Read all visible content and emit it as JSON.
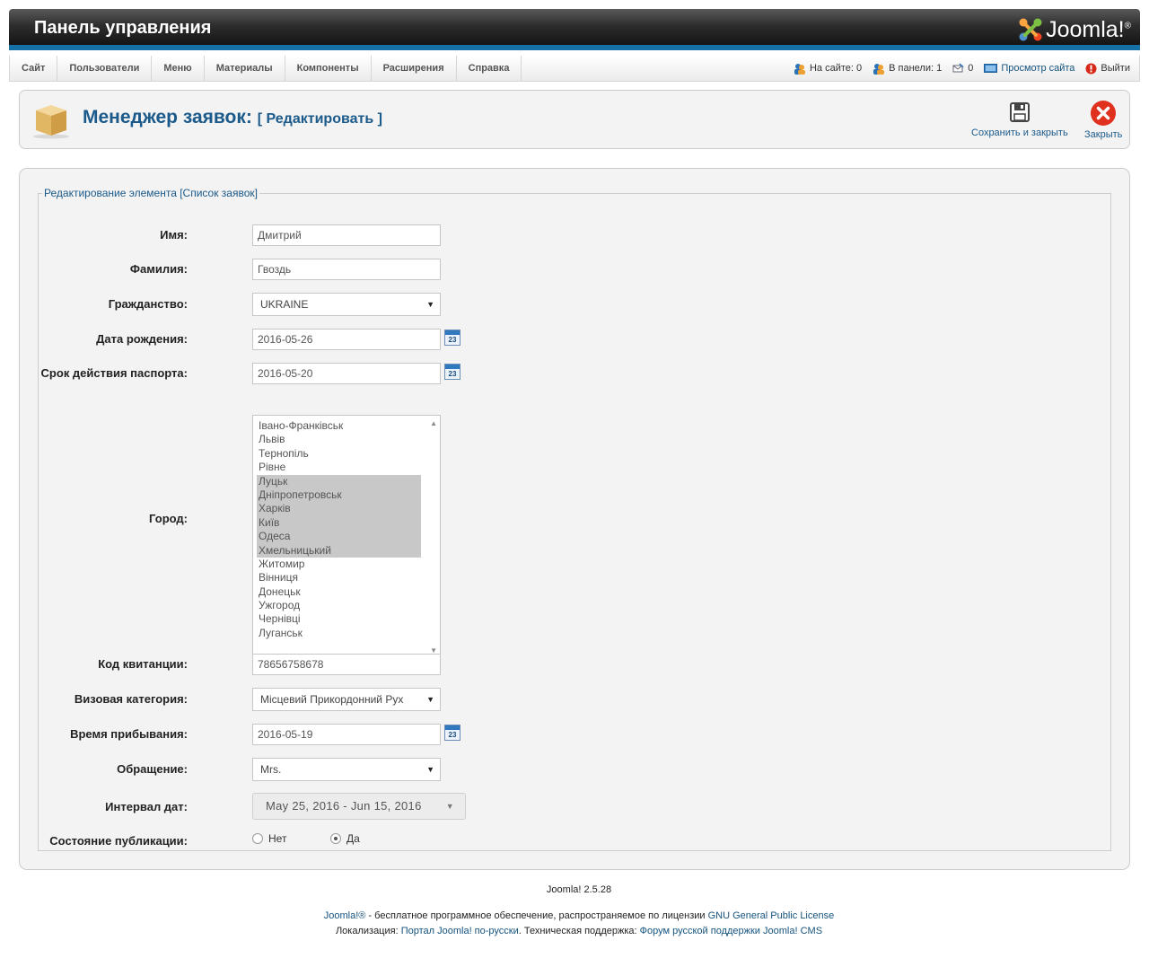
{
  "header": {
    "title": "Панель управления",
    "logo_text": "Joomla!",
    "logo_mark": "®"
  },
  "menu": {
    "items": [
      "Сайт",
      "Пользователи",
      "Меню",
      "Материалы",
      "Компоненты",
      "Расширения",
      "Справка"
    ]
  },
  "status": {
    "online_site": "На сайте: 0",
    "in_panel": "В панели: 1",
    "messages": "0",
    "view_site": "Просмотр сайта",
    "logout": "Выйти"
  },
  "toolbar": {
    "title": "Менеджер заявок:",
    "subtitle": "[ Редактировать ]",
    "save_close": "Сохранить и закрыть",
    "close": "Закрыть"
  },
  "form": {
    "legend": "Редактирование элемента [Список заявок]",
    "first_name": {
      "label": "Имя:",
      "value": "Дмитрий"
    },
    "last_name": {
      "label": "Фамилия:",
      "value": "Гвоздь"
    },
    "citizenship": {
      "label": "Гражданство:",
      "value": "UKRAINE"
    },
    "birth_date": {
      "label": "Дата рождения:",
      "value": "2016-05-26",
      "cal": "23"
    },
    "passport_expiry": {
      "label": "Срок действия паспорта:",
      "value": "2016-05-20",
      "cal": "23"
    },
    "city": {
      "label": "Город:",
      "options": [
        {
          "name": "Івано-Франківськ",
          "selected": false
        },
        {
          "name": "Львів",
          "selected": false
        },
        {
          "name": "Тернопіль",
          "selected": false
        },
        {
          "name": "Рівне",
          "selected": false
        },
        {
          "name": "Луцьк",
          "selected": true
        },
        {
          "name": "Дніпропетровськ",
          "selected": true
        },
        {
          "name": "Харків",
          "selected": true
        },
        {
          "name": "Київ",
          "selected": true
        },
        {
          "name": "Одеса",
          "selected": true
        },
        {
          "name": "Хмельницький",
          "selected": true
        },
        {
          "name": "Житомир",
          "selected": false
        },
        {
          "name": "Вінниця",
          "selected": false
        },
        {
          "name": "Донецьк",
          "selected": false
        },
        {
          "name": "Ужгород",
          "selected": false
        },
        {
          "name": "Чернівці",
          "selected": false
        },
        {
          "name": "Луганськ",
          "selected": false
        }
      ]
    },
    "receipt_code": {
      "label": "Код квитанции:",
      "value": "78656758678"
    },
    "visa_category": {
      "label": "Визовая категория:",
      "value": "Місцевий Прикордонний Рух"
    },
    "arrival_time": {
      "label": "Время прибывания:",
      "value": "2016-05-19",
      "cal": "23"
    },
    "salutation": {
      "label": "Обращение:",
      "value": "Mrs."
    },
    "date_range": {
      "label": "Интервал дат:",
      "value": "May 25, 2016 - Jun 15, 2016"
    },
    "publish_state": {
      "label": "Состояние публикации:",
      "no": "Нет",
      "yes": "Да",
      "selected": "yes"
    }
  },
  "footer": {
    "version": "Joomla! 2.5.28",
    "line1_link1": "Joomla!®",
    "line1_text": " - бесплатное программное обеспечение, распространяемое по лицензии ",
    "line1_link2": "GNU General Public License",
    "line2_text1": "Локализация: ",
    "line2_link1": "Портал Joomla! по-русски",
    "line2_text2": ". Техническая поддержка: ",
    "line2_link2": "Форум русской поддержки Joomla! CMS"
  },
  "colors": {
    "accent": "#1570a6",
    "title_blue": "#1b5a8a",
    "close_red": "#e0301e"
  }
}
